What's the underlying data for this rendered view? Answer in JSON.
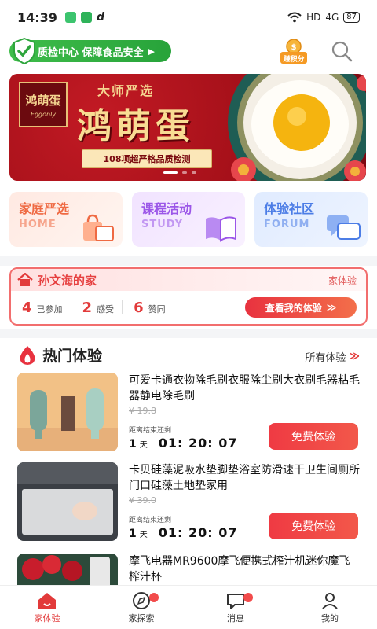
{
  "status_bar": {
    "time": "14:39",
    "network": "HD",
    "signal": "4G",
    "battery": "87"
  },
  "header": {
    "qc_label": "质检中心 保障食品安全",
    "qc_arrow": "▶",
    "points_label": "赚积分"
  },
  "banner": {
    "brand_cn": "鸿萌蛋",
    "brand_en": "Eggonly",
    "subtitle": "大师严选",
    "title": "鸿萌蛋",
    "check_text": "108项超严格品质检测"
  },
  "categories": [
    {
      "title": "家庭严选",
      "en": "HOME"
    },
    {
      "title": "课程活动",
      "en": "STUDY"
    },
    {
      "title": "体验社区",
      "en": "FORUM"
    }
  ],
  "family": {
    "name": "孙文海的家",
    "tag": "家体验",
    "stats": [
      {
        "num": "4",
        "label": "已参加"
      },
      {
        "num": "2",
        "label": "感受"
      },
      {
        "num": "6",
        "label": "赞同"
      }
    ],
    "button": "查看我的体验",
    "button_chev": "≫"
  },
  "hot": {
    "title": "热门体验",
    "all_link": "所有体验",
    "all_chev": "≫"
  },
  "products": [
    {
      "name": "可爱卡通衣物除毛刷衣服除尘刷大衣刷毛器粘毛器静电除毛刷",
      "price": "¥ 19.8",
      "end_label": "距离结束还剩",
      "days": "1",
      "day_unit": "天",
      "time": "01: 20: 07",
      "button": "免费体验"
    },
    {
      "name": "卡贝硅藻泥吸水垫脚垫浴室防滑速干卫生间厕所门口硅藻土地垫家用",
      "price": "¥ 39.0",
      "end_label": "距离结束还剩",
      "days": "1",
      "day_unit": "天",
      "time": "01: 20: 07",
      "button": "免费体验"
    },
    {
      "name": "摩飞电器MR9600摩飞便携式榨汁机迷你魔飞榨汁杯",
      "price": "",
      "end_label": "",
      "days": "",
      "day_unit": "",
      "time": "",
      "button": ""
    }
  ],
  "nav": [
    {
      "label": "家体验"
    },
    {
      "label": "家探索"
    },
    {
      "label": "消息"
    },
    {
      "label": "我的"
    }
  ],
  "colors": {
    "accent": "#e23a3a",
    "qc_green": "#2fae3f",
    "banner_red": "#a5101a"
  }
}
